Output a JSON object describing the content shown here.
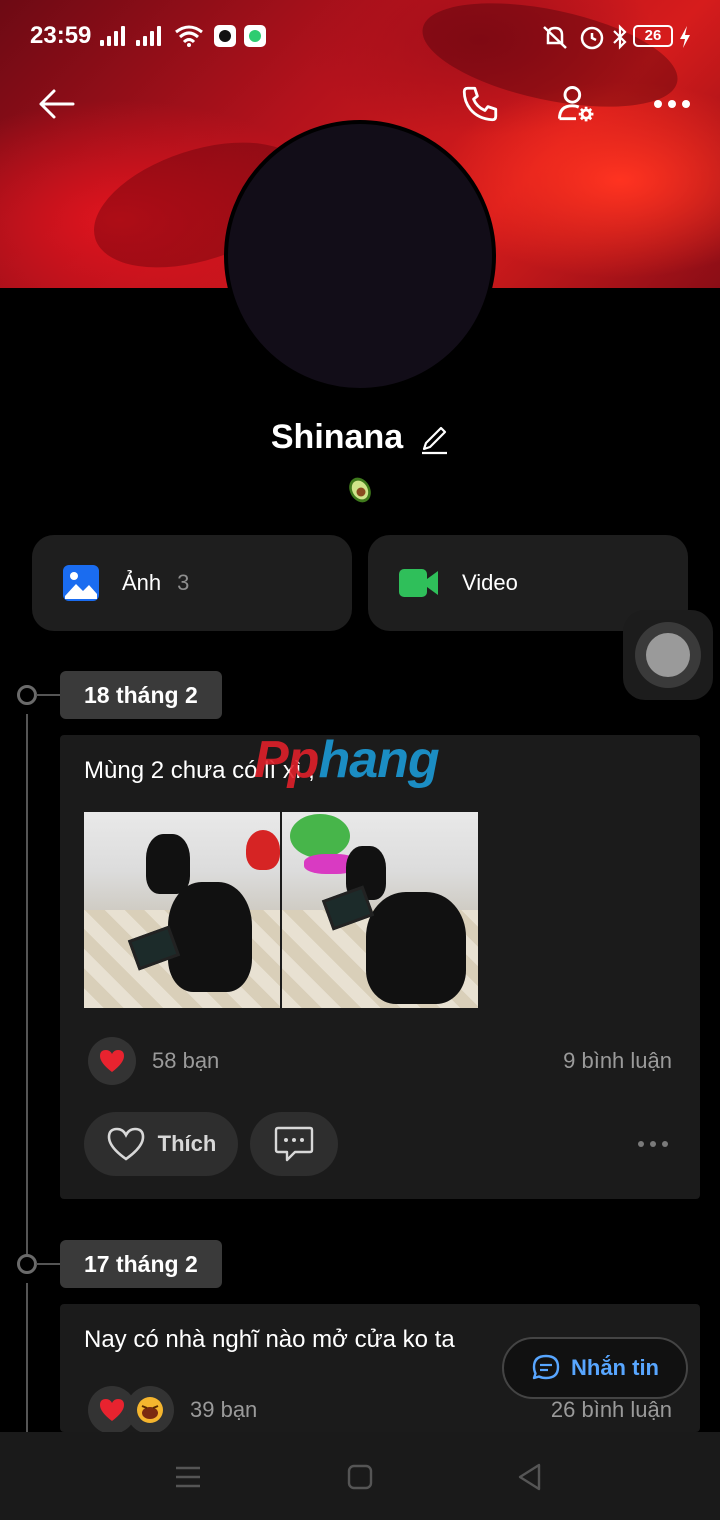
{
  "status_bar": {
    "time": "23:59",
    "battery": "26"
  },
  "profile": {
    "name": "Shinana",
    "status_emoji": "avocado"
  },
  "media": {
    "photos_label": "Ảnh",
    "photos_count": "3",
    "video_label": "Video"
  },
  "watermark": {
    "part1": "Pp",
    "part2": "hang"
  },
  "posts": [
    {
      "date": "18 tháng 2",
      "text": "Mùng 2 chưa có lì xì ,",
      "reaction_count": "58 bạn",
      "comments": "9 bình luận",
      "like_label": "Thích"
    },
    {
      "date": "17 tháng 2",
      "text": "Nay có nhà nghĩ nào mở cửa ko ta",
      "reaction_count": "39 bạn",
      "comments": "26 bình luận"
    }
  ],
  "message_button": {
    "label": "Nhắn tin"
  },
  "colors": {
    "accent": "#58a6ff",
    "photo_icon": "#1a6cf0",
    "video_icon": "#2fbf5a",
    "heart": "#e8232f"
  },
  "icons": [
    "back-arrow-icon",
    "phone-icon",
    "user-settings-icon",
    "more-icon",
    "edit-icon",
    "image-icon",
    "video-camera-icon",
    "heart-icon",
    "comment-icon",
    "chat-icon"
  ]
}
